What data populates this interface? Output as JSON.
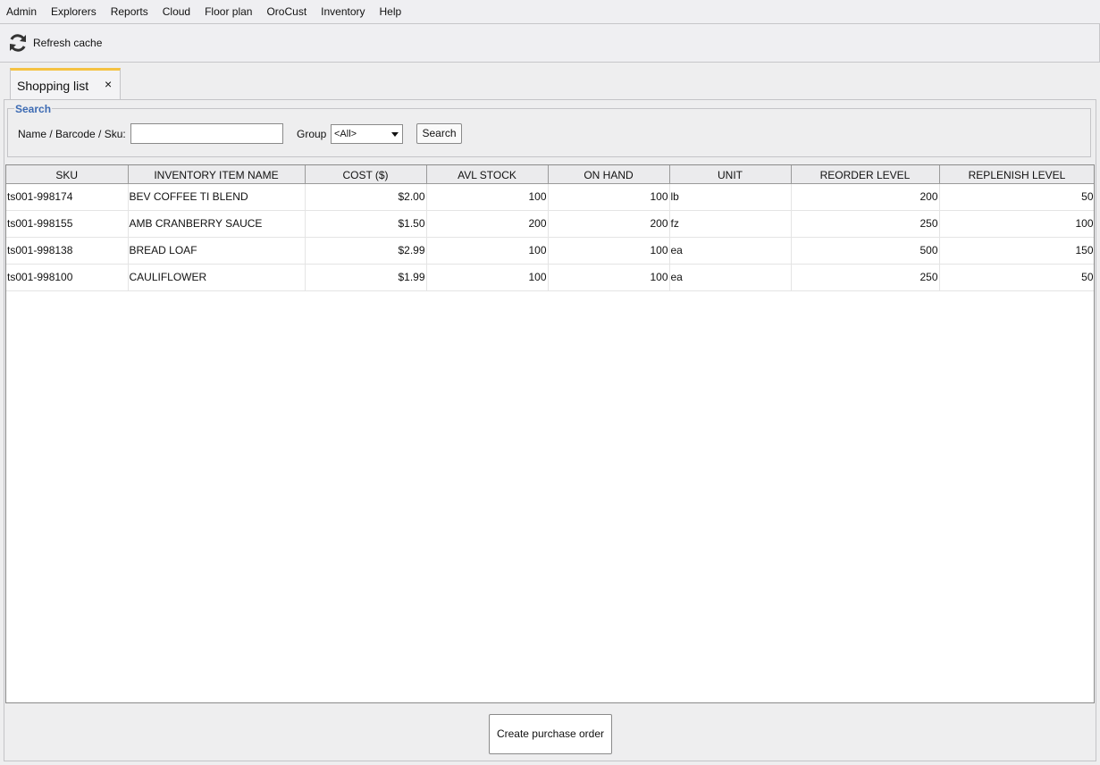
{
  "menu": {
    "items": [
      "Admin",
      "Explorers",
      "Reports",
      "Cloud",
      "Floor plan",
      "OroCust",
      "Inventory",
      "Help"
    ]
  },
  "toolbar": {
    "refresh_label": "Refresh cache",
    "refresh_icon": "refresh-icon"
  },
  "tab": {
    "label": "Shopping list",
    "close_glyph": "×"
  },
  "search": {
    "legend": "Search",
    "name_label": "Name / Barcode / Sku:",
    "name_value": "",
    "group_label": "Group",
    "group_value": "<All>",
    "button_label": "Search"
  },
  "table": {
    "columns": [
      "SKU",
      "INVENTORY ITEM NAME",
      "COST ($)",
      "AVL STOCK",
      "ON HAND",
      "UNIT",
      "REORDER LEVEL",
      "REPLENISH LEVEL"
    ],
    "rows": [
      [
        "ts001-998174",
        "BEV COFFEE TI BLEND",
        "$2.00",
        "100",
        "100",
        "lb",
        "200",
        "50"
      ],
      [
        "ts001-998155",
        "AMB CRANBERRY SAUCE",
        "$1.50",
        "200",
        "200",
        "fz",
        "250",
        "100"
      ],
      [
        "ts001-998138",
        "BREAD LOAF",
        "$2.99",
        "100",
        "100",
        "ea",
        "500",
        "150"
      ],
      [
        "ts001-998100",
        "CAULIFLOWER",
        "$1.99",
        "100",
        "100",
        "ea",
        "250",
        "50"
      ]
    ]
  },
  "footer": {
    "create_po_label": "Create purchase order"
  },
  "colors": {
    "accent_tab": "#f5c242",
    "legend_blue": "#3d6bb3"
  }
}
